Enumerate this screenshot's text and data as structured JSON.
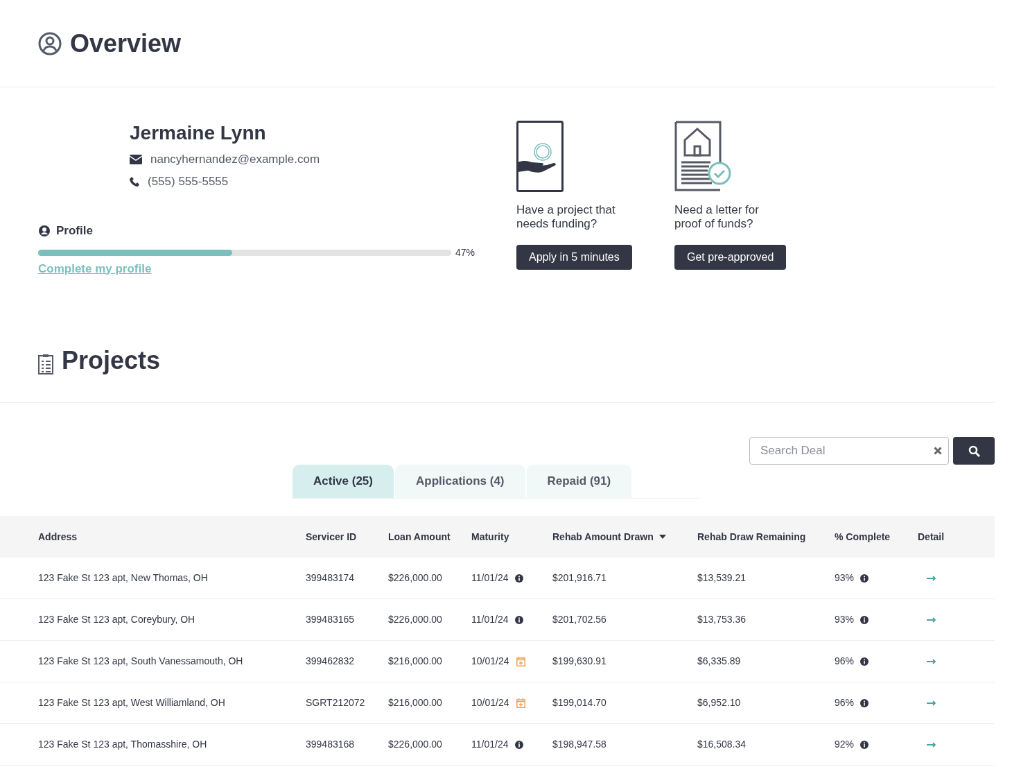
{
  "overview": {
    "title": "Overview"
  },
  "profile": {
    "name": "Jermaine Lynn",
    "email": "nancyhernandez@example.com",
    "phone": "(555) 555-5555",
    "section_label": "Profile",
    "level": 0.47,
    "percent": "47%",
    "link": "Complete my profile"
  },
  "promos": [
    {
      "kind": "funding",
      "text": "Have a project that needs funding?",
      "button": "Apply in 5 minutes"
    },
    {
      "kind": "proof",
      "text": "Need a letter for proof of funds?",
      "button": "Get pre-approved"
    }
  ],
  "projects": {
    "title": "Projects",
    "search": {
      "placeholder": "Search Deal"
    },
    "tabs": [
      {
        "label": "Active (25)",
        "selected": true
      },
      {
        "label": "Applications (4)",
        "selected": false
      },
      {
        "label": "Repaid (91)",
        "selected": false
      }
    ],
    "columns": [
      {
        "label": "Address",
        "sorted": false
      },
      {
        "label": "Servicer ID",
        "sorted": false
      },
      {
        "label": "Loan Amount",
        "sorted": false
      },
      {
        "label": "Maturity",
        "sorted": false
      },
      {
        "label": "Rehab Amount Drawn",
        "sorted": true
      },
      {
        "label": "Rehab Draw Remaining",
        "sorted": false
      },
      {
        "label": "% Complete",
        "sorted": false
      },
      {
        "label": "Detail",
        "sorted": false
      }
    ],
    "rows": [
      {
        "address": "123 Fake St 123 apt, New Thomas, OH",
        "servicer_id": "399483174",
        "loan_amount": "$226,000.00",
        "maturity": {
          "date": "11/01/24",
          "kind": "info"
        },
        "drawn": "$201,916.71",
        "remaining": "$13,539.21",
        "complete": "93%"
      },
      {
        "address": "123 Fake St 123 apt, Coreybury, OH",
        "servicer_id": "399483165",
        "loan_amount": "$226,000.00",
        "maturity": {
          "date": "11/01/24",
          "kind": "info"
        },
        "drawn": "$201,702.56",
        "remaining": "$13,753.36",
        "complete": "93%"
      },
      {
        "address": "123 Fake St 123 apt, South Vanessamouth, OH",
        "servicer_id": "399462832",
        "loan_amount": "$216,000.00",
        "maturity": {
          "date": "10/01/24",
          "kind": "calendar"
        },
        "drawn": "$199,630.91",
        "remaining": "$6,335.89",
        "complete": "96%"
      },
      {
        "address": "123 Fake St 123 apt, West Williamland, OH",
        "servicer_id": "SGRT212072",
        "loan_amount": "$216,000.00",
        "maturity": {
          "date": "10/01/24",
          "kind": "calendar"
        },
        "drawn": "$199,014.70",
        "remaining": "$6,952.10",
        "complete": "96%"
      },
      {
        "address": "123 Fake St 123 apt, Thomasshire, OH",
        "servicer_id": "399483168",
        "loan_amount": "$226,000.00",
        "maturity": {
          "date": "11/01/24",
          "kind": "info"
        },
        "drawn": "$198,947.58",
        "remaining": "$16,508.34",
        "complete": "92%"
      }
    ]
  }
}
